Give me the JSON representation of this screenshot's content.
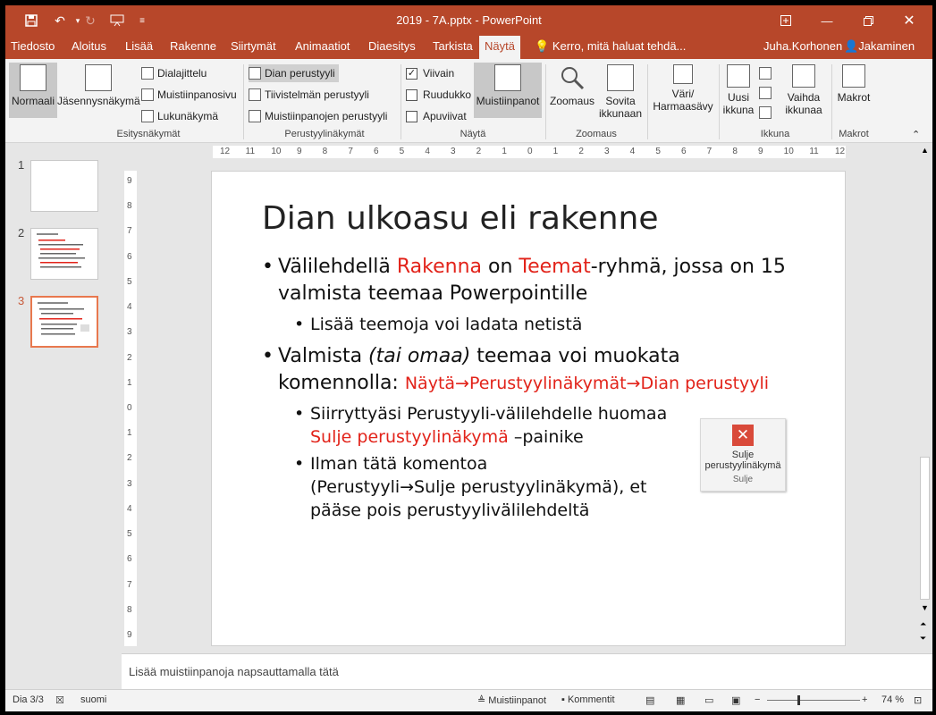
{
  "window": {
    "title": "2019 - 7A.pptx - PowerPoint"
  },
  "tabs": [
    "Tiedosto",
    "Aloitus",
    "Lisää",
    "Rakenne",
    "Siirtymät",
    "Animaatiot",
    "Diaesitys",
    "Tarkista",
    "Näytä"
  ],
  "active_tab": "Näytä",
  "tell_me": "Kerro, mitä haluat tehdä...",
  "user": "Juha.Korhonen",
  "share": "Jakaminen",
  "ribbon": {
    "normal": "Normaali",
    "outline": "Jäsennysnäkymä",
    "slide_sorter": "Dialajittelu",
    "notes_page": "Muistiinpanosivu",
    "reading": "Lukunäkymä",
    "group_views": "Esitysnäkymät",
    "slide_master": "Dian perustyyli",
    "handout_master": "Tiivistelmän perustyyli",
    "notes_master": "Muistiinpanojen perustyyli",
    "group_master": "Perustyylinäkymät",
    "ruler": "Viivain",
    "gridlines": "Ruudukko",
    "guides": "Apuviivat",
    "ruler_checked": true,
    "gridlines_checked": false,
    "guides_checked": false,
    "notes": "Muistiinpanot",
    "group_show": "Näytä",
    "zoom": "Zoomaus",
    "fit": "Sovita ikkunaan",
    "fit_line1": "Sovita",
    "fit_line2": "ikkunaan",
    "group_zoom": "Zoomaus",
    "color_line1": "Väri/",
    "color_line2": "Harmaasävy",
    "new_window_line1": "Uusi",
    "new_window_line2": "ikkuna",
    "switch_line1": "Vaihda",
    "switch_line2": "ikkunaa",
    "group_window": "Ikkuna",
    "macros": "Makrot",
    "group_macros": "Makrot"
  },
  "thumbnails": [
    "1",
    "2",
    "3"
  ],
  "active_slide": "3",
  "ruler_h": [
    "12",
    "11",
    "10",
    "9",
    "8",
    "7",
    "6",
    "5",
    "4",
    "3",
    "2",
    "1",
    "0",
    "1",
    "2",
    "3",
    "4",
    "5",
    "6",
    "7",
    "8",
    "9",
    "10",
    "11",
    "12"
  ],
  "ruler_v": [
    "9",
    "8",
    "7",
    "6",
    "5",
    "4",
    "3",
    "2",
    "1",
    "0",
    "1",
    "2",
    "3",
    "4",
    "5",
    "6",
    "7",
    "8",
    "9"
  ],
  "slide": {
    "title": "Dian ulkoasu eli rakenne",
    "b1_pre": "Välilehdellä ",
    "b1_r1": "Rakenna",
    "b1_mid": " on ",
    "b1_r2": "Teemat",
    "b1_post": "-ryhmä, jossa on 15",
    "b1_line2": "valmista teemaa Powerpointille",
    "b1_sub": "Lisää teemoja voi ladata netistä",
    "b2_pre": "Valmista ",
    "b2_it": "(tai omaa)",
    "b2_post": " teemaa voi muokata",
    "b2_line2_pre": "komennolla: ",
    "b2_cmd": "Näytä→Perustyylinäkymät→Dian perustyyli",
    "s1_line1": "Siirryttyäsi Perustyyli-välilehdelle huomaa",
    "s1_red": "Sulje perustyylinäkymä",
    "s1_post": " –painike",
    "s2_line1": "Ilman tätä komentoa",
    "s2_line2": "(Perustyyli→Sulje perustyylinäkymä), et",
    "s2_line3": "pääse pois perustyylivälilehdeltä"
  },
  "sulje_button": {
    "line1": "Sulje",
    "line2": "perustyylinäkymä",
    "group": "Sulje"
  },
  "notes_placeholder": "Lisää muistiinpanoja napsauttamalla tätä",
  "status": {
    "slide": "Dia 3/3",
    "language": "suomi",
    "notes": "Muistiinpanot",
    "comments": "Kommentit",
    "zoom": "74 %"
  }
}
